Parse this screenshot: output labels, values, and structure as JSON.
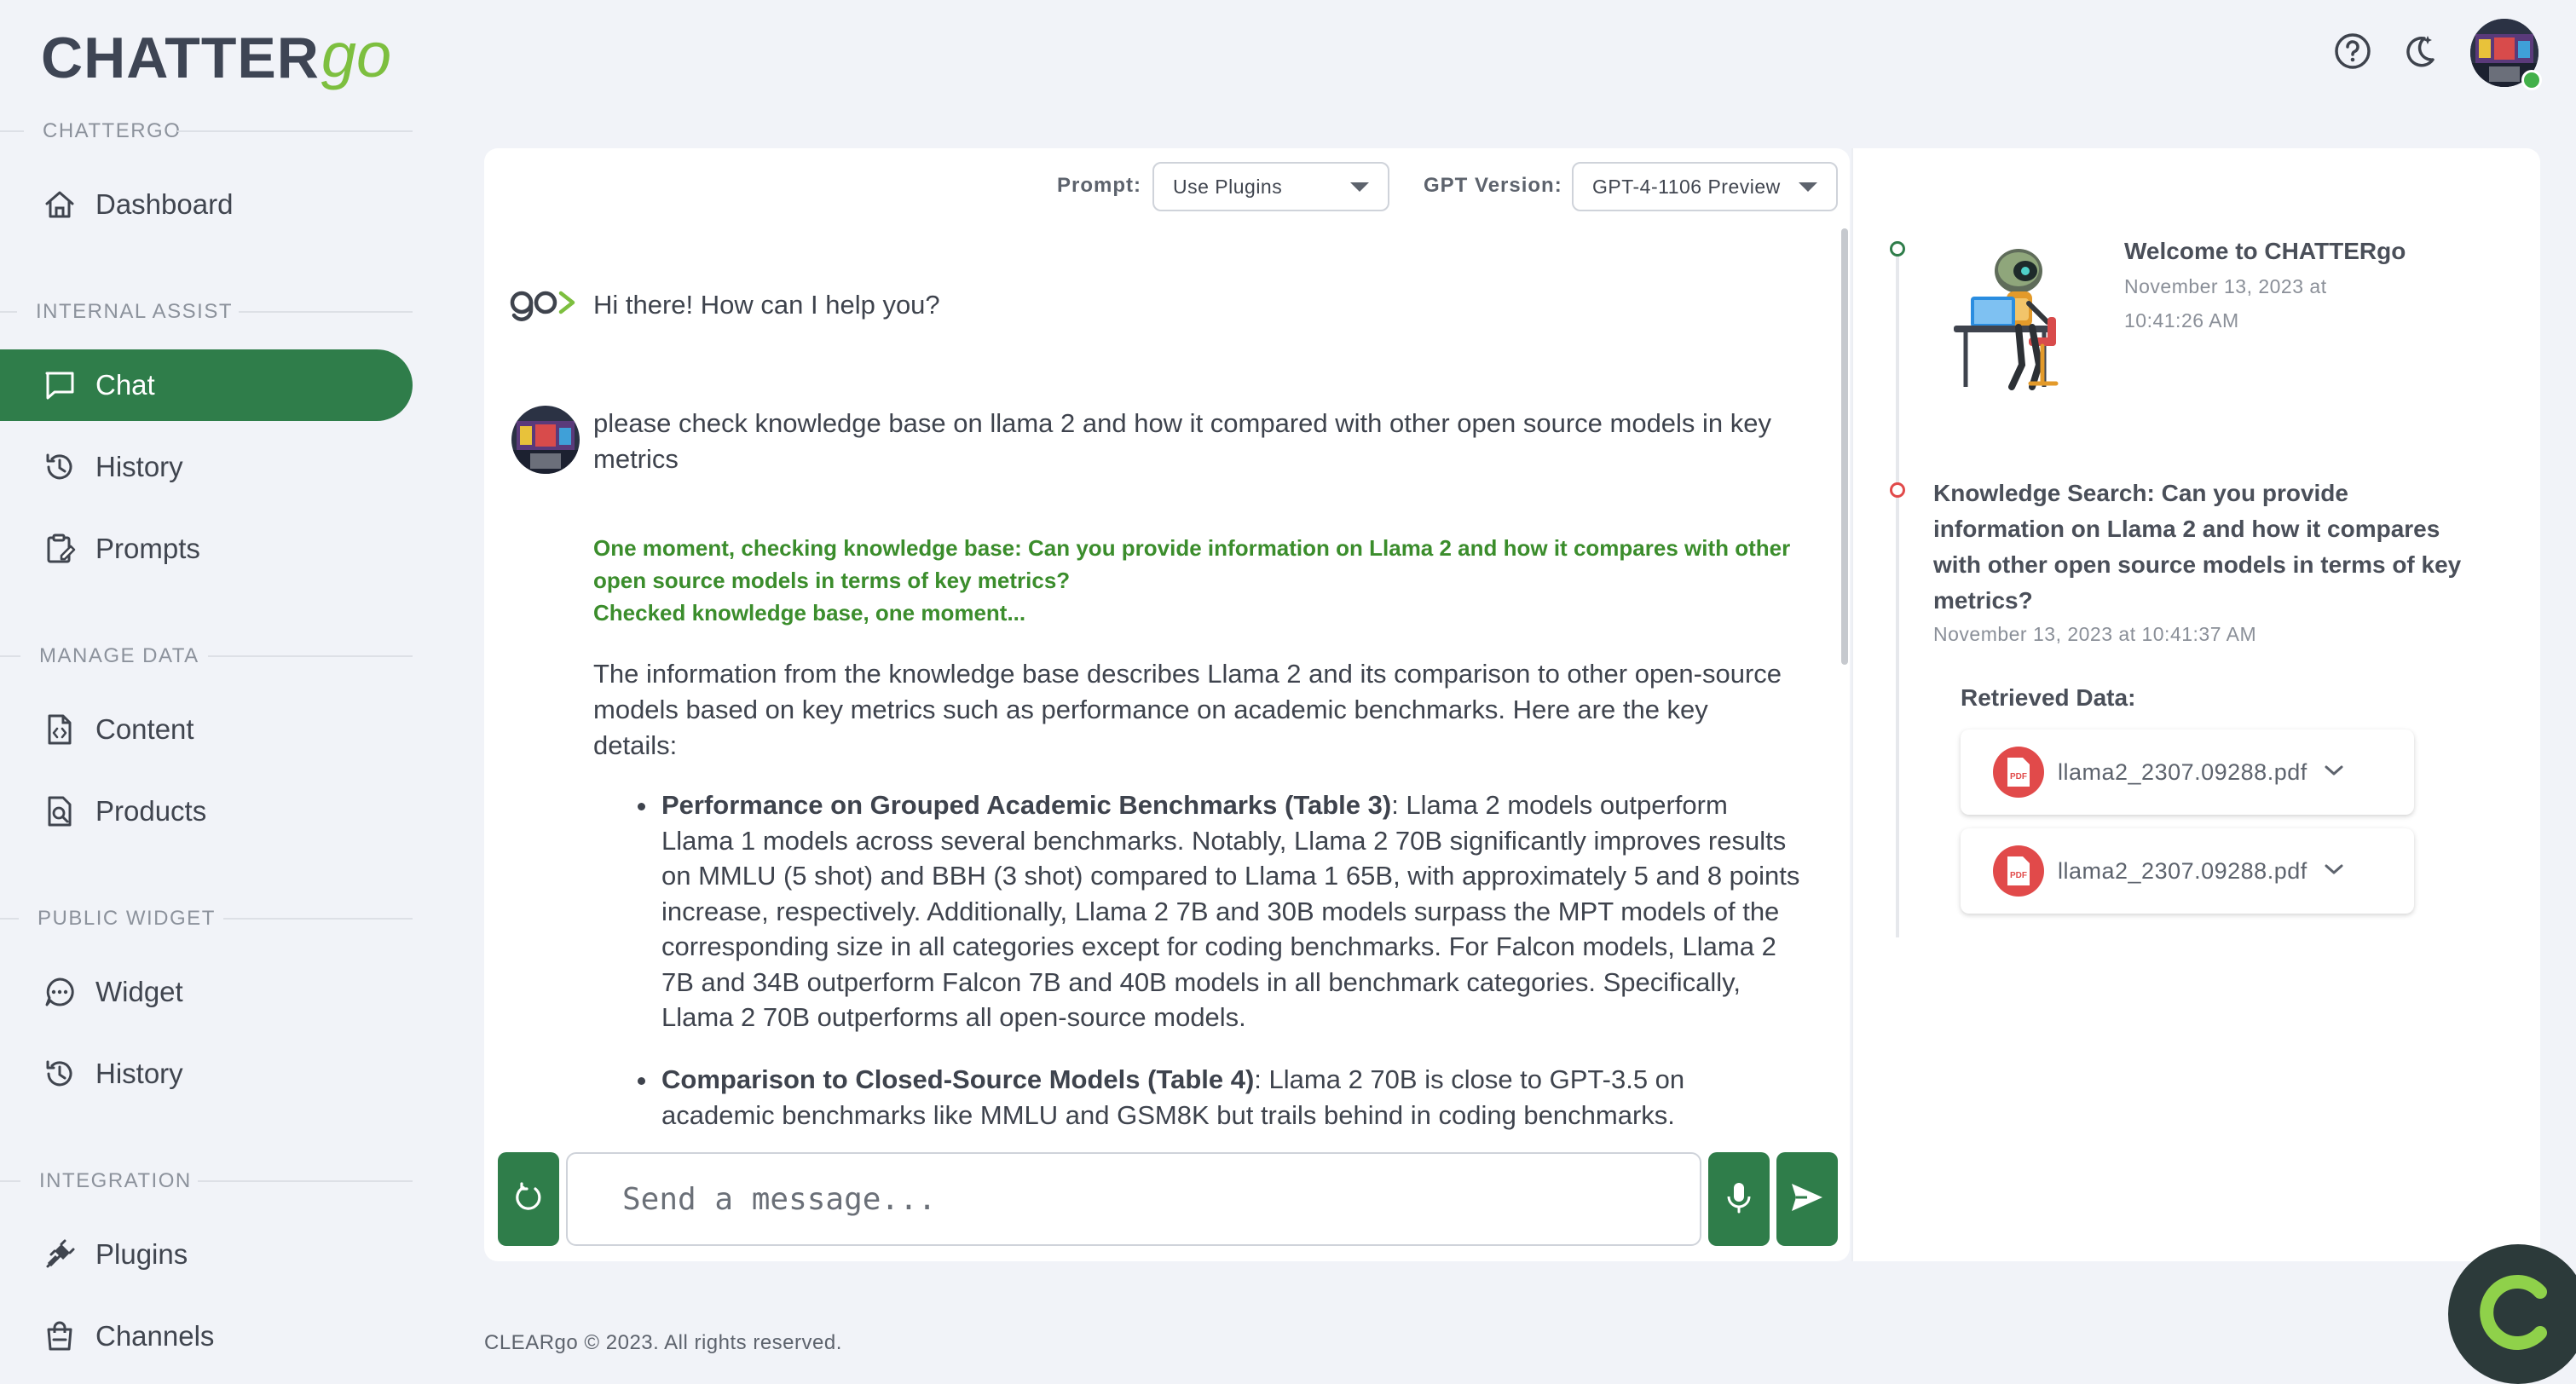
{
  "brand": {
    "logo_main": "CHATTER",
    "logo_go": "go"
  },
  "sidebar": {
    "sections": [
      {
        "label": "CHATTERGO"
      },
      {
        "label": "INTERNAL ASSIST"
      },
      {
        "label": "MANAGE DATA"
      },
      {
        "label": "PUBLIC WIDGET"
      },
      {
        "label": "INTEGRATION"
      }
    ],
    "items": [
      {
        "label": "Dashboard",
        "icon": "home-icon"
      },
      {
        "label": "Chat",
        "icon": "chat-icon",
        "active": true
      },
      {
        "label": "History",
        "icon": "history-icon"
      },
      {
        "label": "Prompts",
        "icon": "prompts-icon"
      },
      {
        "label": "Content",
        "icon": "content-icon"
      },
      {
        "label": "Products",
        "icon": "products-icon"
      },
      {
        "label": "Widget",
        "icon": "widget-icon"
      },
      {
        "label": "History",
        "icon": "history-icon"
      },
      {
        "label": "Plugins",
        "icon": "plugins-icon"
      },
      {
        "label": "Channels",
        "icon": "channels-icon"
      }
    ]
  },
  "toolbar": {
    "prompt_label": "Prompt:",
    "prompt_value": "Use Plugins",
    "gpt_label": "GPT Version:",
    "gpt_value": "GPT-4-1106 Preview"
  },
  "chat": {
    "bot_greeting": "Hi there! How can I help you?",
    "user_message": "please check knowledge base on llama 2 and how it compared with other open source models in key metrics",
    "status_line1": "One moment, checking knowledge base: Can you provide information on Llama 2 and how it compares with other open source models in terms of key metrics?",
    "status_line2": "Checked knowledge base, one moment...",
    "answer_intro": "The information from the knowledge base describes Llama 2 and its comparison to other open-source models based on key metrics such as performance on academic benchmarks. Here are the key details:",
    "bullets": [
      {
        "title": "Performance on Grouped Academic Benchmarks (Table 3)",
        "text": ": Llama 2 models outperform Llama 1 models across several benchmarks. Notably, Llama 2 70B significantly improves results on MMLU (5 shot) and BBH (3 shot) compared to Llama 1 65B, with approximately 5 and 8 points increase, respectively. Additionally, Llama 2 7B and 30B models surpass the MPT models of the corresponding size in all categories except for coding benchmarks. For Falcon models, Llama 2 7B and 34B outperform Falcon 7B and 40B models in all benchmark categories. Specifically, Llama 2 70B outperforms all open-source models."
      },
      {
        "title": "Comparison to Closed-Source Models (Table 4)",
        "text": ": Llama 2 70B is close to GPT-3.5 on academic benchmarks like MMLU and GSM8K but trails behind in coding benchmarks."
      }
    ],
    "input_placeholder": "Send a message..."
  },
  "timeline": {
    "events": [
      {
        "title": "Welcome to CHATTERgo",
        "date": "November 13, 2023 at 10:41:26 AM",
        "dot_color": "#2f7d4a"
      },
      {
        "title": "Knowledge Search: Can you provide information on Llama 2 and how it compares with other open source models in terms of key metrics?",
        "date": "November 13, 2023 at 10:41:37 AM",
        "dot_color": "#e14a4a"
      }
    ],
    "retrieved_label": "Retrieved Data:",
    "files": [
      {
        "name": "llama2_2307.09288.pdf",
        "icon_text": "PDF"
      },
      {
        "name": "llama2_2307.09288.pdf",
        "icon_text": "PDF"
      }
    ]
  },
  "footer": {
    "copyright": "CLEARgo © 2023. All rights reserved."
  },
  "colors": {
    "primary": "#2f7d4a",
    "accent_green": "#7dbf3f",
    "status_green": "#3b8d2c",
    "pdf_red": "#e14a4a"
  }
}
